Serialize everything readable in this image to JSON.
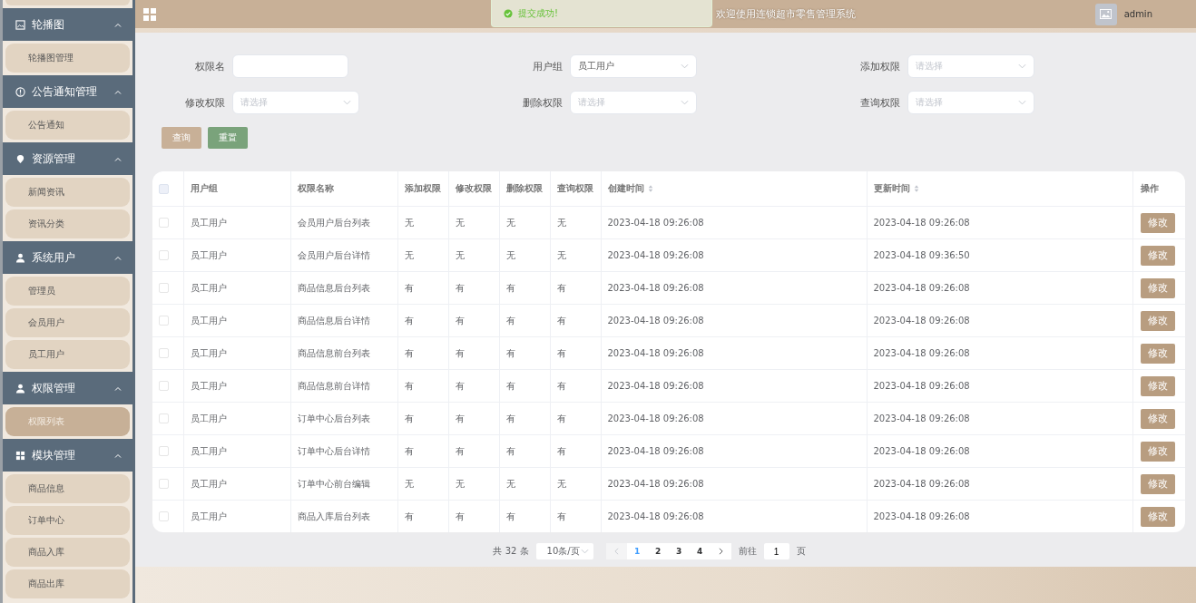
{
  "header": {
    "title": "欢迎使用连锁超市零售管理系统",
    "user": "admin"
  },
  "toast": {
    "text": "提交成功!"
  },
  "sidebar": {
    "groups": [
      {
        "title": "轮播图",
        "expanded": true,
        "items": [
          {
            "label": "轮播图管理",
            "selected": false
          }
        ]
      },
      {
        "title": "公告通知管理",
        "expanded": true,
        "items": [
          {
            "label": "公告通知",
            "selected": false
          }
        ]
      },
      {
        "title": "资源管理",
        "expanded": true,
        "items": [
          {
            "label": "新闻资讯",
            "selected": false
          },
          {
            "label": "资讯分类",
            "selected": false
          }
        ]
      },
      {
        "title": "系统用户",
        "expanded": true,
        "items": [
          {
            "label": "管理员",
            "selected": false
          },
          {
            "label": "会员用户",
            "selected": false
          },
          {
            "label": "员工用户",
            "selected": false
          }
        ]
      },
      {
        "title": "权限管理",
        "expanded": true,
        "items": [
          {
            "label": "权限列表",
            "selected": true
          }
        ]
      },
      {
        "title": "模块管理",
        "expanded": true,
        "items": [
          {
            "label": "商品信息",
            "selected": false
          },
          {
            "label": "订单中心",
            "selected": false
          },
          {
            "label": "商品入库",
            "selected": false
          },
          {
            "label": "商品出库",
            "selected": false
          }
        ]
      }
    ]
  },
  "filters": [
    {
      "label": "权限名",
      "kind": "input"
    },
    {
      "label": "用户组",
      "kind": "select",
      "value": "员工用户"
    },
    {
      "label": "添加权限",
      "kind": "select",
      "placeholder": "请选择"
    },
    {
      "label": "修改权限",
      "kind": "select",
      "placeholder": "请选择"
    },
    {
      "label": "删除权限",
      "kind": "select",
      "placeholder": "请选择"
    },
    {
      "label": "查询权限",
      "kind": "select",
      "placeholder": "请选择"
    }
  ],
  "buttons": {
    "search": "查询",
    "reset": "重置"
  },
  "table": {
    "header_checked": false,
    "columns": [
      {
        "label": "用户组",
        "sortable": false
      },
      {
        "label": "权限名称",
        "sortable": false
      },
      {
        "label": "添加权限",
        "sortable": false
      },
      {
        "label": "修改权限",
        "sortable": false
      },
      {
        "label": "删除权限",
        "sortable": false
      },
      {
        "label": "查询权限",
        "sortable": false
      },
      {
        "label": "创建时间",
        "sortable": true
      },
      {
        "label": "更新时间",
        "sortable": true
      },
      {
        "label": "操作",
        "sortable": false
      }
    ],
    "rows": [
      {
        "checked": false,
        "cells": [
          "员工用户",
          "会员用户后台列表",
          "无",
          "无",
          "无",
          "无",
          "2023-04-18 09:26:08",
          "2023-04-18 09:26:08"
        ],
        "action": "修改"
      },
      {
        "checked": false,
        "cells": [
          "员工用户",
          "会员用户后台详情",
          "无",
          "无",
          "无",
          "无",
          "2023-04-18 09:26:08",
          "2023-04-18 09:36:50"
        ],
        "action": "修改"
      },
      {
        "checked": false,
        "cells": [
          "员工用户",
          "商品信息后台列表",
          "有",
          "有",
          "有",
          "有",
          "2023-04-18 09:26:08",
          "2023-04-18 09:26:08"
        ],
        "action": "修改"
      },
      {
        "checked": false,
        "cells": [
          "员工用户",
          "商品信息后台详情",
          "有",
          "有",
          "有",
          "有",
          "2023-04-18 09:26:08",
          "2023-04-18 09:26:08"
        ],
        "action": "修改"
      },
      {
        "checked": false,
        "cells": [
          "员工用户",
          "商品信息前台列表",
          "有",
          "有",
          "有",
          "有",
          "2023-04-18 09:26:08",
          "2023-04-18 09:26:08"
        ],
        "action": "修改"
      },
      {
        "checked": false,
        "cells": [
          "员工用户",
          "商品信息前台详情",
          "有",
          "有",
          "有",
          "有",
          "2023-04-18 09:26:08",
          "2023-04-18 09:26:08"
        ],
        "action": "修改"
      },
      {
        "checked": false,
        "cells": [
          "员工用户",
          "订单中心后台列表",
          "有",
          "有",
          "有",
          "有",
          "2023-04-18 09:26:08",
          "2023-04-18 09:26:08"
        ],
        "action": "修改"
      },
      {
        "checked": false,
        "cells": [
          "员工用户",
          "订单中心后台详情",
          "有",
          "有",
          "有",
          "有",
          "2023-04-18 09:26:08",
          "2023-04-18 09:26:08"
        ],
        "action": "修改"
      },
      {
        "checked": false,
        "cells": [
          "员工用户",
          "订单中心前台编辑",
          "无",
          "无",
          "无",
          "无",
          "2023-04-18 09:26:08",
          "2023-04-18 09:26:08"
        ],
        "action": "修改"
      },
      {
        "checked": false,
        "cells": [
          "员工用户",
          "商品入库后台列表",
          "有",
          "有",
          "有",
          "有",
          "2023-04-18 09:26:08",
          "2023-04-18 09:26:08"
        ],
        "action": "修改"
      }
    ]
  },
  "pagination": {
    "total": "共 32 条",
    "page_size": "10条/页",
    "prev_disabled": true,
    "pages": [
      {
        "label": "1",
        "selected": true
      },
      {
        "label": "2",
        "selected": false
      },
      {
        "label": "3",
        "selected": false
      },
      {
        "label": "4",
        "selected": false
      }
    ],
    "goto_label": "前往",
    "goto_value": "1",
    "page_suffix": "页"
  }
}
